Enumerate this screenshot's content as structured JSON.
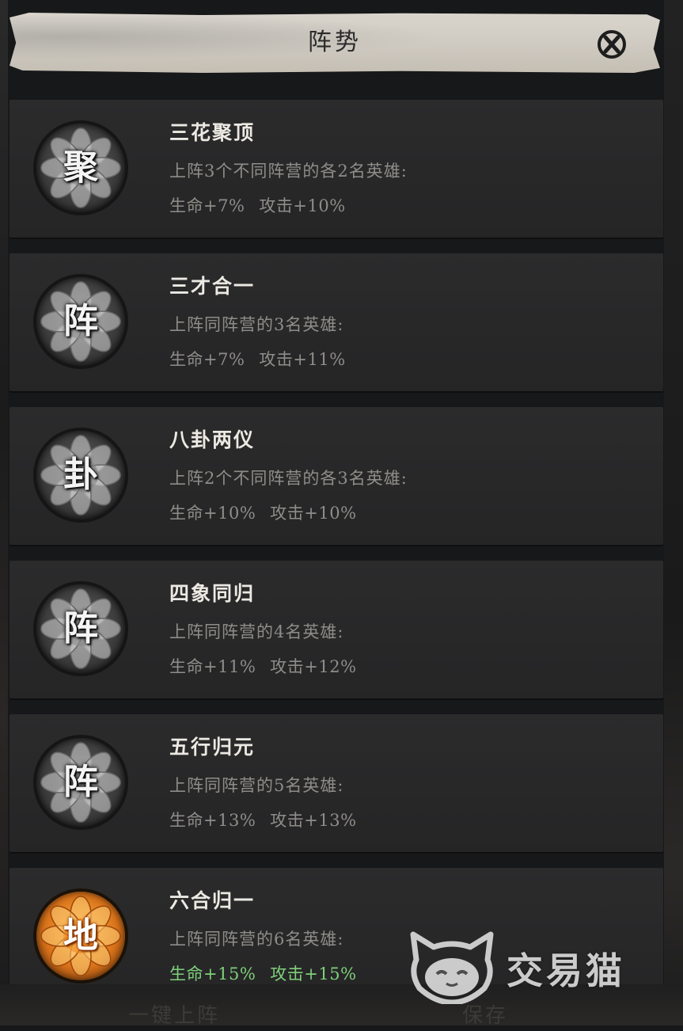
{
  "header": {
    "title": "阵势",
    "close_icon": "close-x-icon"
  },
  "formations": [
    {
      "emblem_char": "聚",
      "emblem_style": "gray",
      "title": "三花聚顶",
      "description": "上阵3个不同阵营的各2名英雄:",
      "hp": "生命+7%",
      "atk": "攻击+10%",
      "active": false
    },
    {
      "emblem_char": "阵",
      "emblem_style": "gray",
      "title": "三才合一",
      "description": "上阵同阵营的3名英雄:",
      "hp": "生命+7%",
      "atk": "攻击+11%",
      "active": false
    },
    {
      "emblem_char": "卦",
      "emblem_style": "gray",
      "title": "八卦两仪",
      "description": "上阵2个不同阵营的各3名英雄:",
      "hp": "生命+10%",
      "atk": "攻击+10%",
      "active": false
    },
    {
      "emblem_char": "阵",
      "emblem_style": "gray",
      "title": "四象同归",
      "description": "上阵同阵营的4名英雄:",
      "hp": "生命+11%",
      "atk": "攻击+12%",
      "active": false
    },
    {
      "emblem_char": "阵",
      "emblem_style": "gray",
      "title": "五行归元",
      "description": "上阵同阵营的5名英雄:",
      "hp": "生命+13%",
      "atk": "攻击+13%",
      "active": false
    },
    {
      "emblem_char": "地",
      "emblem_style": "gold",
      "title": "六合归一",
      "description": "上阵同阵营的6名英雄:",
      "hp": "生命+15%",
      "atk": "攻击+15%",
      "active": true
    }
  ],
  "colors": {
    "active_stat": "#7fd07a",
    "inactive_stat": "#8f8d89",
    "gold_emblem": "#d9731a"
  },
  "bottom": {
    "left_button": "一键上阵",
    "right_button": "保存"
  },
  "watermark": {
    "text": "交易猫",
    "icon": "cat-logo-icon"
  }
}
